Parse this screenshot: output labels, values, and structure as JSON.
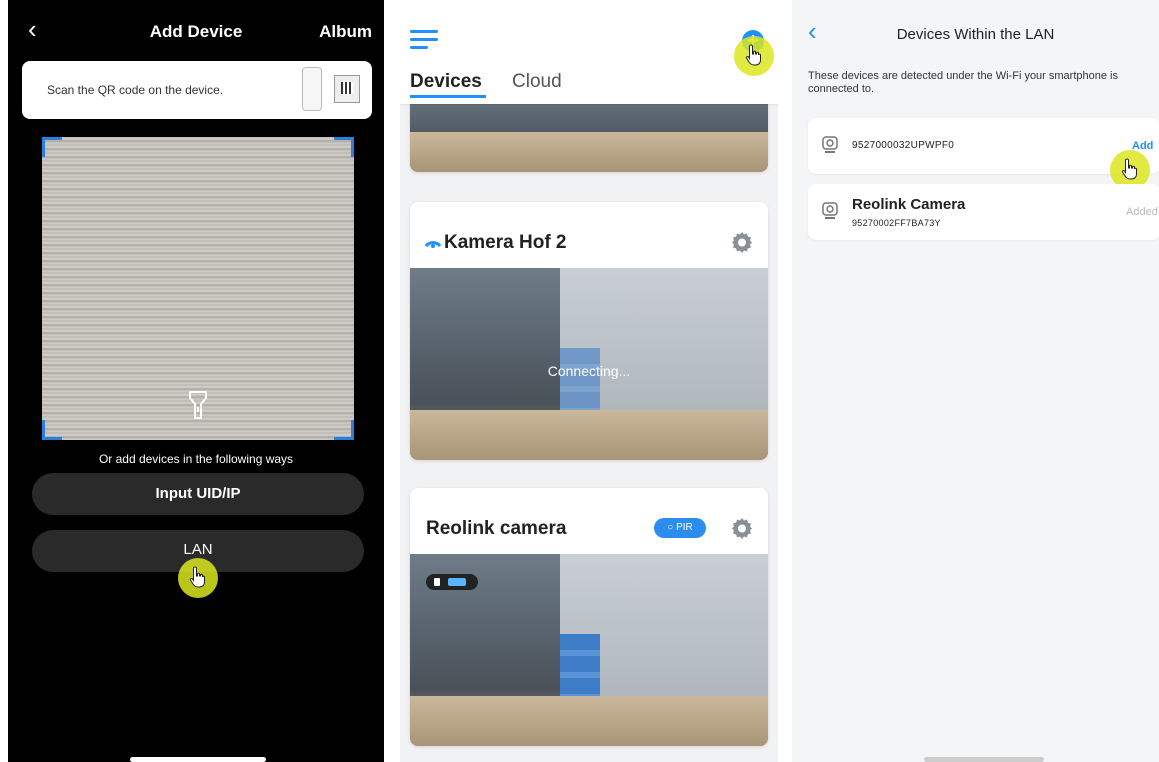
{
  "add_device": {
    "title": "Add Device",
    "album_label": "Album",
    "scan_hint": "Scan the QR code on the device.",
    "alt_ways_text": "Or add devices in the following ways",
    "input_uid_label": "Input UID/IP",
    "lan_label": "LAN"
  },
  "devices": {
    "tab_devices": "Devices",
    "tab_cloud": "Cloud",
    "cards": [
      {
        "name": "Kamera Hof 2",
        "status": "Connecting..."
      },
      {
        "name": "Reolink camera",
        "badge": "PIR"
      }
    ]
  },
  "lan": {
    "title": "Devices Within the LAN",
    "description": "These devices are detected under the Wi-Fi your smartphone is connected to.",
    "devices": [
      {
        "uid": "9527000032UPWPF0",
        "action": "Add"
      },
      {
        "name": "Reolink Camera",
        "uid": "95270002FF7BA73Y",
        "action": "Added"
      }
    ]
  },
  "colors": {
    "accent": "#1e90ff",
    "tap_highlight": "#dce61e"
  }
}
